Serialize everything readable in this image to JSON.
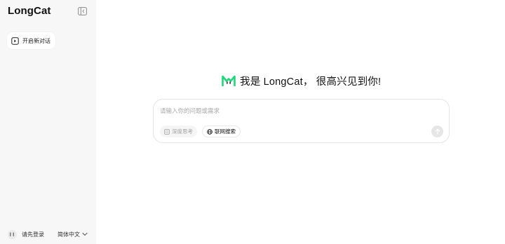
{
  "sidebar": {
    "brand": "LongCat",
    "new_chat_label": "开启新对话",
    "login_label": "请先登录",
    "language_label": "简体中文"
  },
  "main": {
    "greeting": "我是 LongCat， 很高兴见到你!",
    "composer": {
      "placeholder": "请输入你的问题或需求",
      "value": "",
      "deep_think_label": "深度思考",
      "web_search_label": "联网搜索"
    }
  },
  "icons": {
    "collapse": "sidebar-collapse-icon",
    "new_chat": "new-chat-icon",
    "avatar": "cat-avatar-icon",
    "language_chevron": "chevron-down-icon",
    "logo": "longcat-logo-icon",
    "deep_think": "deep-think-icon",
    "web_search": "globe-icon",
    "send": "arrow-up-icon"
  },
  "colors": {
    "sidebar_bg": "#f6f7f6",
    "brand_green": "#1fd67a",
    "send_disabled": "#e5e6e5",
    "placeholder_text": "#a7a8a7"
  }
}
